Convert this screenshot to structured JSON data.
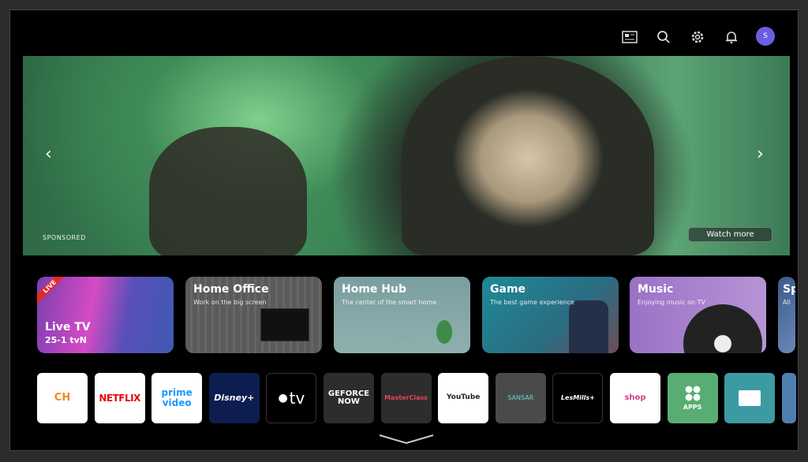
{
  "top_bar": {
    "icons": [
      "guide-icon",
      "search-icon",
      "settings-icon",
      "notifications-icon"
    ],
    "avatar_initial": "S",
    "avatar_color": "#6a5fe0"
  },
  "hero": {
    "sponsored_label": "SPONSORED",
    "watch_more_label": "Watch more"
  },
  "cards": [
    {
      "title": "Live TV",
      "subtitle": "25-1  tvN",
      "badge": "LIVE"
    },
    {
      "title": "Home Office",
      "subtitle": "Work on the big screen"
    },
    {
      "title": "Home Hub",
      "subtitle": "The center of the smart home"
    },
    {
      "title": "Game",
      "subtitle": "The best game experience"
    },
    {
      "title": "Music",
      "subtitle": "Enjoying music on TV"
    },
    {
      "title": "Sp",
      "subtitle": "All"
    }
  ],
  "apps": [
    {
      "label": "CH",
      "bg": "#ffffff"
    },
    {
      "label": "NETFLIX",
      "bg": "#ffffff"
    },
    {
      "label": "prime video",
      "bg": "#ffffff"
    },
    {
      "label": "Disney+",
      "bg": "#0e1d4f"
    },
    {
      "label": "tv",
      "bg": "#000000"
    },
    {
      "label": "GEFORCE NOW",
      "bg": "#2d2d2d"
    },
    {
      "label": "MasterClass",
      "bg": "#2d2d2d"
    },
    {
      "label": "YouTube",
      "bg": "#ffffff"
    },
    {
      "label": "SANSAR",
      "bg": "#4a4a4a"
    },
    {
      "label": "LesMills+",
      "bg": "#000000"
    },
    {
      "label": "shop",
      "bg": "#ffffff"
    },
    {
      "label": "APPS",
      "bg": "#58ad73"
    },
    {
      "label": "",
      "bg": "#3c9aa3"
    },
    {
      "label": "",
      "bg": "#4f7fb0"
    }
  ]
}
